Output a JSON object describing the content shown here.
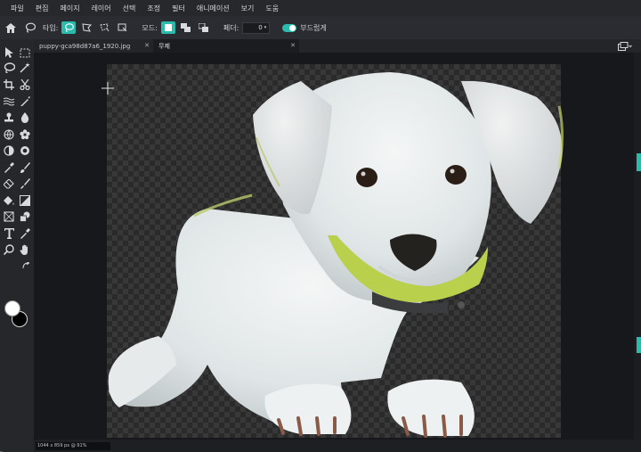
{
  "menu": [
    "파일",
    "편집",
    "페이지",
    "레이어",
    "선택",
    "조정",
    "필터",
    "애니메이션",
    "보기",
    "도움"
  ],
  "options": {
    "type_label": "타입:",
    "mode_label": "모드:",
    "feather_label": "페더:",
    "feather_value": "0",
    "smooth_label": "부드럽게"
  },
  "tabs": [
    {
      "label": "puppy-gca98d87a6_1920.jpg"
    },
    {
      "label": "무제"
    }
  ],
  "status": {
    "text": "1044 x 859 px @ 91%"
  },
  "colors": {
    "accent": "#2bbbad",
    "foreground": "#ffffff",
    "background": "#000000"
  },
  "icons": [
    "home-icon",
    "lasso-icon",
    "polygon-lasso-icon",
    "magnetic-lasso-icon",
    "move-icon",
    "marquee-icon",
    "magic-wand-icon",
    "crop-icon",
    "scissors-icon",
    "brush-icon",
    "hand-icon",
    "zoom-icon"
  ]
}
